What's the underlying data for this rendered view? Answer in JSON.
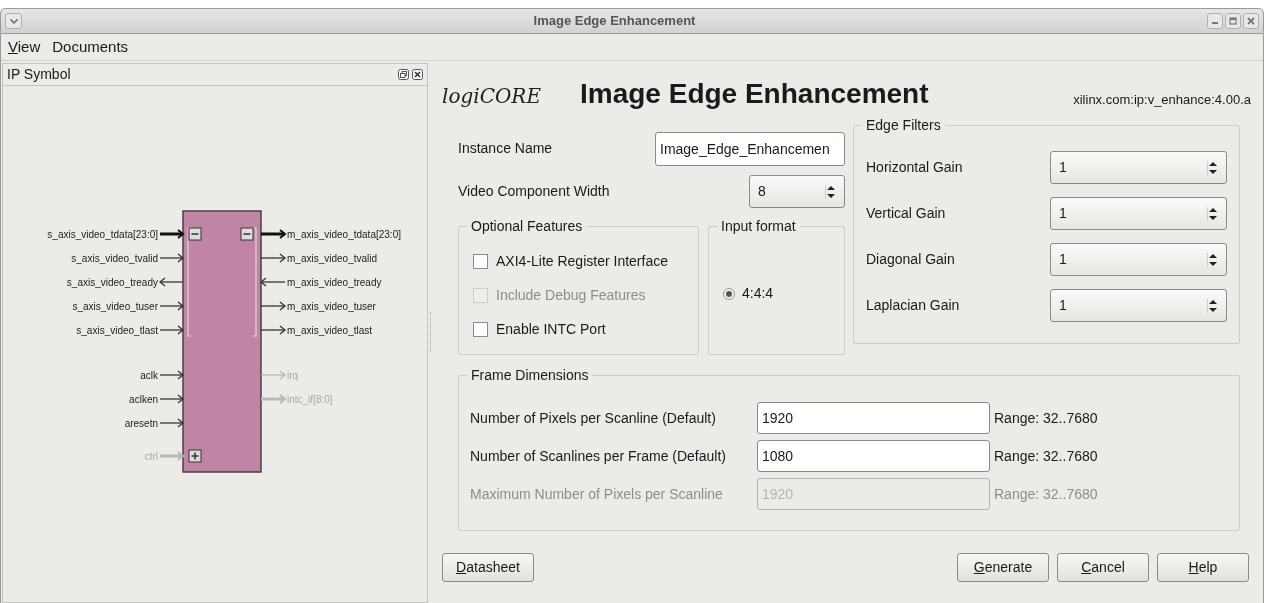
{
  "window": {
    "title": "Image Edge Enhancement"
  },
  "menu": [
    {
      "label": "View",
      "mnemonic_first": true
    },
    {
      "label": "Documents",
      "mnemonic_first": false
    }
  ],
  "ip_symbol": {
    "title": "IP Symbol",
    "left_groups": [
      {
        "ports": [
          {
            "name": "s_axis_video_tdata[23:0]",
            "kind": "in",
            "bus": true,
            "enabled": true
          },
          {
            "name": "s_axis_video_tvalid",
            "kind": "in",
            "bus": false,
            "enabled": true
          },
          {
            "name": "s_axis_video_tready",
            "kind": "out",
            "bus": false,
            "enabled": true
          },
          {
            "name": "s_axis_video_tuser",
            "kind": "in",
            "bus": false,
            "enabled": true
          },
          {
            "name": "s_axis_video_tlast",
            "kind": "in",
            "bus": false,
            "enabled": true
          }
        ]
      },
      {
        "ports": [
          {
            "name": "aclk",
            "kind": "in",
            "bus": false,
            "enabled": true
          },
          {
            "name": "aclken",
            "kind": "in",
            "bus": false,
            "enabled": true
          },
          {
            "name": "aresetn",
            "kind": "in",
            "bus": false,
            "enabled": true
          }
        ]
      },
      {
        "ports": [
          {
            "name": "ctrl",
            "kind": "in",
            "bus": true,
            "enabled": false
          }
        ]
      }
    ],
    "right_groups": [
      {
        "ports": [
          {
            "name": "m_axis_video_tdata[23:0]",
            "kind": "out",
            "bus": true,
            "enabled": true
          },
          {
            "name": "m_axis_video_tvalid",
            "kind": "out",
            "bus": false,
            "enabled": true
          },
          {
            "name": "m_axis_video_tready",
            "kind": "in",
            "bus": false,
            "enabled": true
          },
          {
            "name": "m_axis_video_tuser",
            "kind": "out",
            "bus": false,
            "enabled": true
          },
          {
            "name": "m_axis_video_tlast",
            "kind": "out",
            "bus": false,
            "enabled": true
          }
        ]
      },
      {
        "ports": [
          {
            "name": "irq",
            "kind": "out",
            "bus": false,
            "enabled": false
          },
          {
            "name": "intc_if[8:0]",
            "kind": "out",
            "bus": true,
            "enabled": false
          }
        ]
      }
    ]
  },
  "header": {
    "logo": "logiCORE",
    "title": "Image Edge Enhancement",
    "version": "xilinx.com:ip:v_enhance:4.00.a"
  },
  "instance_name": {
    "label": "Instance Name",
    "value": "Image_Edge_Enhancemen"
  },
  "video_component_width": {
    "label": "Video Component Width",
    "value": "8"
  },
  "optional_features": {
    "title": "Optional Features",
    "options": [
      {
        "label": "AXI4-Lite Register Interface",
        "checked": false,
        "disabled": false
      },
      {
        "label": "Include Debug Features",
        "checked": false,
        "disabled": true
      },
      {
        "label": "Enable INTC Port",
        "checked": false,
        "disabled": false
      }
    ]
  },
  "input_format": {
    "title": "Input format",
    "options": [
      {
        "label": "4:4:4",
        "selected": true
      }
    ]
  },
  "edge_filters": {
    "title": "Edge Filters",
    "gains": [
      {
        "label": "Horizontal Gain",
        "value": "1"
      },
      {
        "label": "Vertical Gain",
        "value": "1"
      },
      {
        "label": "Diagonal Gain",
        "value": "1"
      },
      {
        "label": "Laplacian Gain",
        "value": "1"
      }
    ]
  },
  "frame_dimensions": {
    "title": "Frame Dimensions",
    "fields": [
      {
        "label": "Number of Pixels per Scanline (Default)",
        "value": "1920",
        "range": "Range: 32..7680",
        "disabled": false
      },
      {
        "label": "Number of Scanlines per Frame (Default)",
        "value": "1080",
        "range": "Range: 32..7680",
        "disabled": false
      },
      {
        "label": "Maximum Number of Pixels per Scanline",
        "value": "1920",
        "range": "Range: 32..7680",
        "disabled": true
      }
    ]
  },
  "buttons_left": [
    {
      "label": "Datasheet",
      "mnemonic_first": true
    }
  ],
  "buttons_right": [
    {
      "label": "Generate",
      "mnemonic_first": true
    },
    {
      "label": "Cancel",
      "mnemonic_first": true
    },
    {
      "label": "Help",
      "mnemonic_first": true
    }
  ]
}
